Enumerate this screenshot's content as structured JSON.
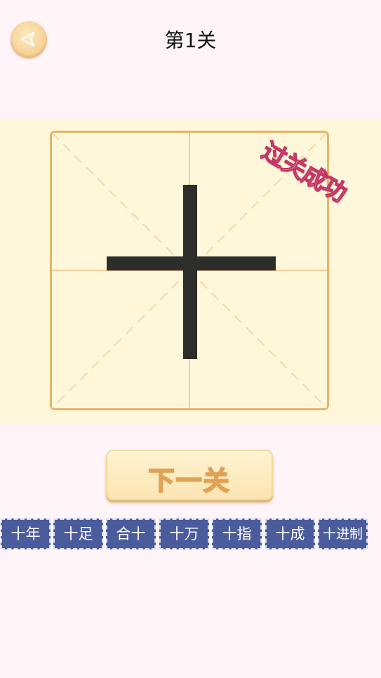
{
  "header": {
    "title": "第1关"
  },
  "board": {
    "character_strokes": [
      "horizontal-stroke",
      "vertical-stroke"
    ],
    "stamp_text": "过关成功"
  },
  "next_button": {
    "label": "下一关"
  },
  "words": [
    {
      "label": "十年"
    },
    {
      "label": "十足"
    },
    {
      "label": "合十"
    },
    {
      "label": "十万"
    },
    {
      "label": "十指"
    },
    {
      "label": "十成"
    },
    {
      "label": "十进制"
    }
  ],
  "colors": {
    "background": "#fff5f8",
    "board": "#fff7d9",
    "grid_border": "#e6b569",
    "stroke": "#2d2d2b",
    "stamp": "#c23563",
    "word_tile": "#4a5c9c"
  }
}
